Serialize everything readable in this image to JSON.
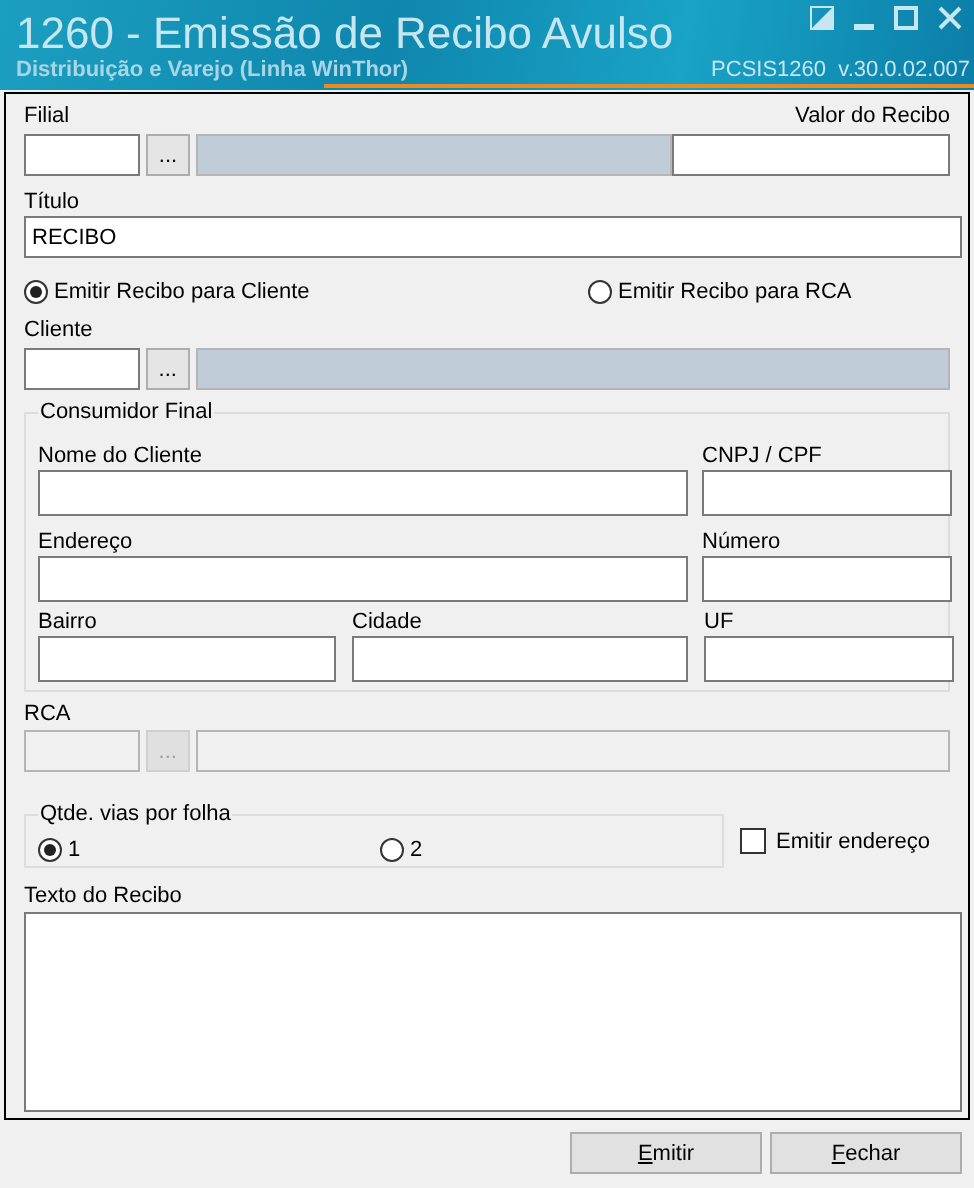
{
  "window": {
    "title": "1260 - Emissão de Recibo Avulso",
    "subtitle": "Distribuição e Varejo (Linha WinThor)",
    "version": "PCSIS1260  v.30.0.02.007"
  },
  "filial": {
    "label": "Filial",
    "disabled": false
  },
  "valor": {
    "label": "Valor do Recibo"
  },
  "titulo": {
    "label": "Título",
    "value": "RECIBO"
  },
  "recipient_options": [
    {
      "label": "Emitir Recibo para Cliente",
      "selected": true
    },
    {
      "label": "Emitir Recibo para RCA",
      "selected": false
    }
  ],
  "cliente": {
    "label": "Cliente",
    "disabled": false
  },
  "consumidor_final": {
    "title": "Consumidor Final",
    "nome": "Nome do Cliente",
    "cnpj": "CNPJ / CPF",
    "endereco": "Endereço",
    "numero": "Número",
    "bairro": "Bairro",
    "cidade": "Cidade",
    "uf": "UF"
  },
  "rca": {
    "label": "RCA",
    "disabled": true
  },
  "copies": {
    "title": "Qtde. vias por folha",
    "options": [
      {
        "label": "1",
        "selected": true
      },
      {
        "label": "2",
        "selected": false
      }
    ]
  },
  "emitir_endereco": {
    "label": "Emitir endereço",
    "checked": false
  },
  "texto": {
    "label": "Texto do Recibo"
  },
  "lookup_button": "...",
  "buttons": [
    {
      "label": "Emitir",
      "underline_first": true
    },
    {
      "label": "Fechar",
      "underline_first": true
    }
  ]
}
